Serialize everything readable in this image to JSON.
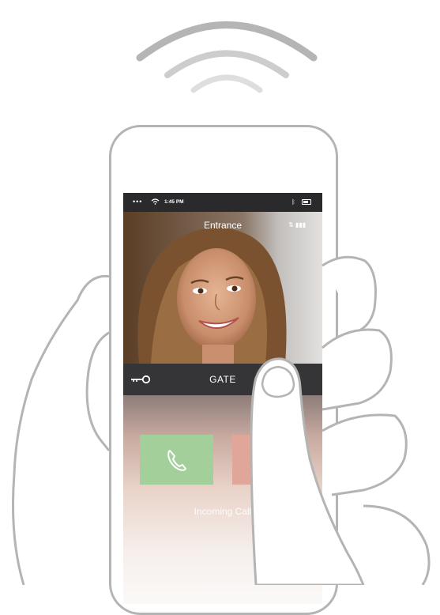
{
  "status_bar": {
    "signal_dots": "•••",
    "time": "1:45 PM",
    "bluetooth_icon": "bluetooth-icon",
    "battery_icon": "battery-icon"
  },
  "video": {
    "title": "Entrance",
    "signal_indicator": "⇅ ▮▮▮"
  },
  "gate": {
    "label": "GATE",
    "key_icon": "key-icon"
  },
  "call": {
    "accept_icon": "phone-icon",
    "decline_icon": "hang-up-icon",
    "status": "Incoming Call"
  },
  "colors": {
    "accept": "#a3cf9b",
    "decline": "#e1a69a",
    "gate_bar": "#353436",
    "status_bar": "#2a2a2c",
    "outline": "#b4b4b4"
  }
}
